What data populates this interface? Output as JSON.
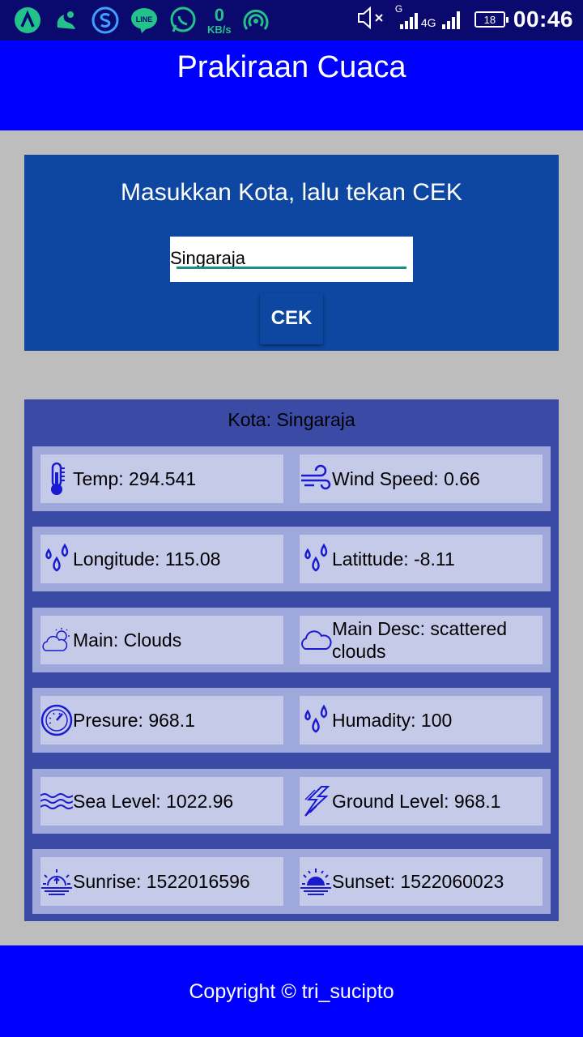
{
  "status_bar": {
    "time": "00:46",
    "battery": "18",
    "net_speed_value": "0",
    "net_speed_unit": "KB/s",
    "signal_1": "G",
    "signal_2": "4G",
    "icons": [
      "a-icon",
      "uc-browser-icon",
      "s-icon",
      "line-icon",
      "whatsapp-icon",
      "hotspot-icon",
      "mute-icon",
      "signal-icon",
      "battery-icon"
    ]
  },
  "app": {
    "title": "Prakiraan Cuaca"
  },
  "input_card": {
    "prompt": "Masukkan Kota, lalu tekan CEK",
    "city_value": "Singaraja",
    "button_label": "CEK"
  },
  "result": {
    "city_line": "Kota: Singaraja",
    "rows": [
      {
        "left": {
          "icon": "thermometer-icon",
          "text": "Temp: 294.541"
        },
        "right": {
          "icon": "wind-icon",
          "text": "Wind Speed: 0.66"
        }
      },
      {
        "left": {
          "icon": "raindrops-icon",
          "text": "Longitude: 115.08"
        },
        "right": {
          "icon": "raindrops-icon",
          "text": "Latittude: -8.11"
        }
      },
      {
        "left": {
          "icon": "cloud-sun-icon",
          "text": "Main: Clouds"
        },
        "right": {
          "icon": "cloud-icon",
          "text": "Main Desc: scattered clouds"
        }
      },
      {
        "left": {
          "icon": "barometer-icon",
          "text": "Presure: 968.1"
        },
        "right": {
          "icon": "raindrops-icon",
          "text": "Humadity: 100"
        }
      },
      {
        "left": {
          "icon": "waves-icon",
          "text": "Sea Level: 1022.96"
        },
        "right": {
          "icon": "lightning-icon",
          "text": "Ground Level: 968.1"
        }
      },
      {
        "left": {
          "icon": "sunrise-icon",
          "text": "Sunrise: 1522016596"
        },
        "right": {
          "icon": "sunset-icon",
          "text": "Sunset: 1522060023"
        }
      }
    ]
  },
  "footer": {
    "text": "Copyright © tri_sucipto"
  },
  "colors": {
    "status_bar": "#0a0a6e",
    "primary": "#0000ff",
    "input_card": "#0d47a1",
    "result_card": "#3a4aa5",
    "row_bg": "#9fa8da",
    "cell_bg": "#c5cae9",
    "icon": "#1a1ad0",
    "background": "#bdbdbd"
  }
}
